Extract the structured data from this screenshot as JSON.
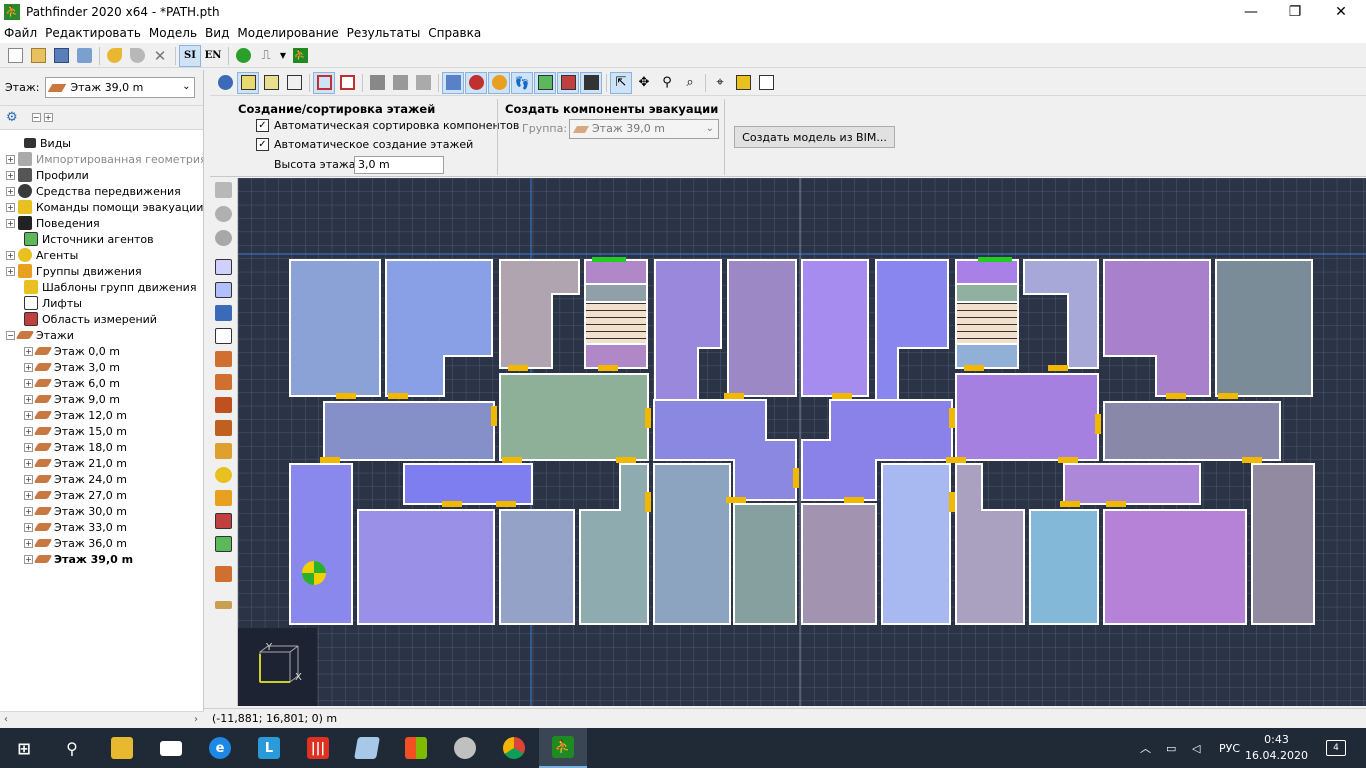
{
  "window": {
    "title": "Pathfinder 2020 x64 - *PATH.pth",
    "minimize": "—",
    "maximize": "❐",
    "close": "✕"
  },
  "menu": [
    "Файл",
    "Редактировать",
    "Модель",
    "Вид",
    "Моделирование",
    "Результаты",
    "Справка"
  ],
  "toolbar": {
    "units_si": "SI",
    "units_en": "EN"
  },
  "floor_selector": {
    "label": "Этаж:",
    "value": "Этаж 39,0 m"
  },
  "tree": {
    "items": [
      {
        "label": "Виды",
        "icon": "views-icon"
      },
      {
        "label": "Импортированная геометрия",
        "icon": "imported-geometry-icon",
        "disabled": true
      },
      {
        "label": "Профили",
        "icon": "profiles-icon"
      },
      {
        "label": "Средства передвижения",
        "icon": "vehicles-icon"
      },
      {
        "label": "Команды помощи эвакуации",
        "icon": "assist-teams-icon"
      },
      {
        "label": "Поведения",
        "icon": "behaviors-icon"
      },
      {
        "label": "Источники агентов",
        "icon": "agent-sources-icon"
      },
      {
        "label": "Агенты",
        "icon": "agents-icon"
      },
      {
        "label": "Группы движения",
        "icon": "movement-groups-icon"
      },
      {
        "label": "Шаблоны групп движения",
        "icon": "group-templates-icon"
      },
      {
        "label": "Лифты",
        "icon": "elevators-icon"
      },
      {
        "label": "Область измерений",
        "icon": "measurement-region-icon"
      },
      {
        "label": "Этажи",
        "icon": "floors-icon"
      }
    ],
    "floors": [
      "Этаж 0,0 m",
      "Этаж 3,0 m",
      "Этаж 6,0 m",
      "Этаж 9,0 m",
      "Этаж 12,0 m",
      "Этаж 15,0 m",
      "Этаж 18,0 m",
      "Этаж 21,0 m",
      "Этаж 24,0 m",
      "Этаж 27,0 m",
      "Этаж 30,0 m",
      "Этаж 33,0 m",
      "Этаж 36,0 m",
      "Этаж 39,0 m"
    ]
  },
  "props": {
    "floors_group_title": "Создание/сортировка этажей",
    "auto_sort_label": "Автоматическая сортировка компонентов",
    "auto_create_label": "Автоматическое создание этажей",
    "floor_height_label": "Высота этажа:",
    "floor_height_value": "3,0 m",
    "evac_group_title": "Создать компоненты эвакуации",
    "group_label": "Группа:",
    "group_value": "Этаж 39,0 m",
    "bim_button": "Создать модель из BIM..."
  },
  "status": {
    "coords": "(-11,881; 16,801; 0) m"
  },
  "axes": {
    "y": "Y",
    "x": "X"
  },
  "tray": {
    "lang": "РУС",
    "time": "0:43",
    "date": "16.04.2020",
    "notifications": "4"
  },
  "colors": {
    "canvas_bg": "#2b3346",
    "door": "#f0b800",
    "exit": "#22cc22"
  }
}
